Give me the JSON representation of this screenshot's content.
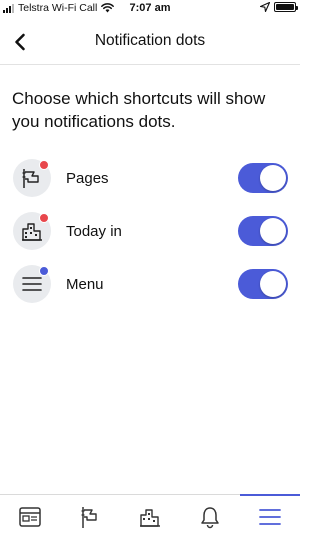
{
  "status_bar": {
    "carrier": "Telstra Wi-Fi Call",
    "time": "7:07 am",
    "signal_bars_filled": 3,
    "icons": [
      "signal-icon",
      "wifi-icon",
      "location-arrow-icon",
      "battery-icon"
    ]
  },
  "header": {
    "title": "Notification dots",
    "back_icon": "chevron-left-icon"
  },
  "description": "Choose which shortcuts will show you notifications dots.",
  "settings": [
    {
      "label": "Pages",
      "icon": "flag-icon",
      "dot_color": "#e8474c",
      "enabled": true
    },
    {
      "label": "Today in",
      "icon": "city-icon",
      "dot_color": "#e8474c",
      "enabled": true
    },
    {
      "label": "Menu",
      "icon": "hamburger-menu-icon",
      "dot_color": "#4b5bd8",
      "enabled": true
    }
  ],
  "tab_bar": {
    "tabs": [
      {
        "name": "news-feed",
        "icon": "news-feed-icon",
        "active": false
      },
      {
        "name": "pages",
        "icon": "flag-icon",
        "active": false
      },
      {
        "name": "today-in",
        "icon": "city-icon",
        "active": false
      },
      {
        "name": "notifications",
        "icon": "bell-icon",
        "active": false
      },
      {
        "name": "menu",
        "icon": "hamburger-menu-icon",
        "active": true
      }
    ]
  },
  "colors": {
    "accent": "#4b5bd8",
    "notification_dot_red": "#e8474c",
    "icon_circle_bg": "#e9ebee",
    "divider": "#e2e2e2"
  }
}
